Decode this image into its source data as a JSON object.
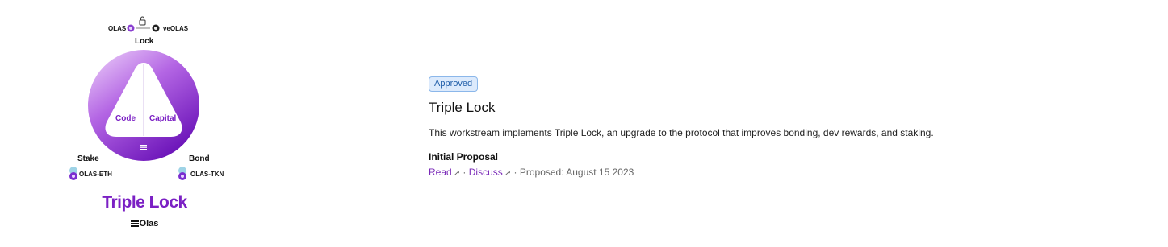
{
  "illustration": {
    "top_left_token": "OLAS",
    "top_right_token": "veOLAS",
    "lock_label": "Lock",
    "left_segment": "Code",
    "right_segment": "Capital",
    "stake_label": "Stake",
    "stake_token": "OLAS-ETH",
    "bond_label": "Bond",
    "bond_token": "OLAS-TKN",
    "title": "Triple Lock",
    "brand": "Olas",
    "colors": {
      "purple": "#7b20c4",
      "lavender": "#e5c8f8"
    }
  },
  "workstream": {
    "status_badge": "Approved",
    "title": "Triple Lock",
    "description": "This workstream implements Triple Lock, an upgrade to the protocol that improves bonding, dev rewards, and staking.",
    "section_title": "Initial Proposal",
    "read_link": "Read",
    "discuss_link": "Discuss",
    "arrow_glyph": "↗",
    "separator": "·",
    "proposed_text": "Proposed: August 15 2023"
  }
}
